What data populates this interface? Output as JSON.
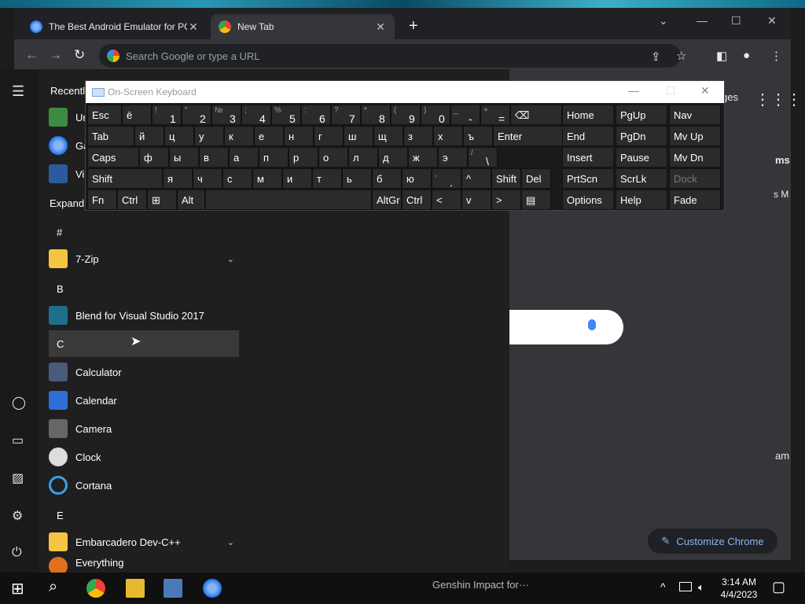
{
  "browser": {
    "tabs": [
      {
        "title": "The Best Android Emulator for PC",
        "close": "✕"
      },
      {
        "title": "New Tab",
        "close": "✕"
      }
    ],
    "new_tab": "+",
    "window_controls": {
      "search_tabs": "⌄",
      "minimize": "—",
      "maximize": "☐",
      "close": "✕"
    },
    "toolbar": {
      "back": "←",
      "forward": "→",
      "reload": "↻",
      "placeholder": "Search Google or type a URL",
      "share": "⇪",
      "bookmark": "☆",
      "sidebar": "◧",
      "profile": "●",
      "menu": "⋮"
    },
    "page": {
      "images_link": "ges",
      "apps_icon": "⋮⋮⋮",
      "customize_label": "Customize Chrome",
      "customize_icon": "✎",
      "side_fragments": [
        "ms",
        "s M",
        "am",
        ")"
      ]
    }
  },
  "start_menu": {
    "hamburger": "☰",
    "recently_added": "Recently",
    "recent": [
      {
        "label": "Ur"
      },
      {
        "label": "Ga"
      },
      {
        "label": "Vi"
      }
    ],
    "expand_label": "Expand",
    "sections": [
      {
        "header": "#",
        "apps": [
          {
            "label": "7-Zip",
            "icon": "folder-icon",
            "expand": "⌄"
          }
        ]
      },
      {
        "header": "B",
        "apps": [
          {
            "label": "Blend for Visual Studio 2017",
            "icon": "blend-icon"
          }
        ]
      },
      {
        "header": "C",
        "apps": [
          {
            "label": "Calculator",
            "icon": "calculator-icon"
          },
          {
            "label": "Calendar",
            "icon": "calendar-icon"
          },
          {
            "label": "Camera",
            "icon": "camera-icon"
          },
          {
            "label": "Clock",
            "icon": "clock-icon"
          },
          {
            "label": "Cortana",
            "icon": "cortana-icon"
          }
        ]
      },
      {
        "header": "E",
        "apps": [
          {
            "label": "Embarcadero Dev-C++",
            "icon": "folder-icon",
            "expand": "⌄"
          },
          {
            "label": "Everything",
            "icon": "everything-icon"
          }
        ]
      }
    ],
    "rail": {
      "user": "◯",
      "documents": "▭",
      "pictures": "▨",
      "settings": "⚙",
      "power": "⏻"
    }
  },
  "osk": {
    "title": "On-Screen Keyboard",
    "controls": {
      "minimize": "—",
      "maximize": "☐",
      "close": "✕"
    },
    "rows": [
      [
        {
          "m": "Esc"
        },
        {
          "m": "ё"
        },
        {
          "s": "!",
          "n": "1"
        },
        {
          "s": "\"",
          "n": "2"
        },
        {
          "s": "№",
          "n": "3"
        },
        {
          "s": ";",
          "n": "4"
        },
        {
          "s": "%",
          "n": "5"
        },
        {
          "s": ":",
          "n": "6"
        },
        {
          "s": "?",
          "n": "7"
        },
        {
          "s": "*",
          "n": "8"
        },
        {
          "s": "(",
          "n": "9"
        },
        {
          "s": ")",
          "n": "0"
        },
        {
          "s": "_",
          "n": "-"
        },
        {
          "s": "+",
          "n": "="
        },
        {
          "m": "⌫"
        }
      ],
      [
        {
          "m": "Tab"
        },
        {
          "m": "й"
        },
        {
          "m": "ц"
        },
        {
          "m": "у"
        },
        {
          "m": "к"
        },
        {
          "m": "е"
        },
        {
          "m": "н"
        },
        {
          "m": "г"
        },
        {
          "m": "ш"
        },
        {
          "m": "щ"
        },
        {
          "m": "з"
        },
        {
          "m": "х"
        },
        {
          "m": "ъ"
        },
        {
          "m": "Enter"
        }
      ],
      [
        {
          "m": "Caps"
        },
        {
          "m": "ф"
        },
        {
          "m": "ы"
        },
        {
          "m": "в"
        },
        {
          "m": "а"
        },
        {
          "m": "п"
        },
        {
          "m": "р"
        },
        {
          "m": "о"
        },
        {
          "m": "л"
        },
        {
          "m": "д"
        },
        {
          "m": "ж"
        },
        {
          "m": "э"
        },
        {
          "s": "/",
          "n": "\\"
        }
      ],
      [
        {
          "m": "Shift"
        },
        {
          "m": "я"
        },
        {
          "m": "ч"
        },
        {
          "m": "с"
        },
        {
          "m": "м"
        },
        {
          "m": "и"
        },
        {
          "m": "т"
        },
        {
          "m": "ь"
        },
        {
          "m": "б"
        },
        {
          "m": "ю"
        },
        {
          "s": ",",
          "n": "."
        },
        {
          "m": "^"
        },
        {
          "m": "Shift"
        },
        {
          "m": "Del"
        }
      ],
      [
        {
          "m": "Fn"
        },
        {
          "m": "Ctrl"
        },
        {
          "m": "⊞"
        },
        {
          "m": "Alt"
        },
        {
          "m": ""
        },
        {
          "m": "AltGr"
        },
        {
          "m": "Ctrl"
        },
        {
          "m": "<"
        },
        {
          "m": "v"
        },
        {
          "m": ">"
        },
        {
          "m": "▤"
        }
      ]
    ],
    "nav_keys": [
      [
        "Home",
        "PgUp",
        "Nav"
      ],
      [
        "End",
        "PgDn",
        "Mv Up"
      ],
      [
        "Insert",
        "Pause",
        "Mv Dn"
      ],
      [
        "PrtScn",
        "ScrLk",
        "Dock"
      ],
      [
        "Options",
        "Help",
        "Fade"
      ]
    ]
  },
  "taskbar": {
    "start": "⊞",
    "search": "⌕",
    "game_label": "Genshin Impact for···",
    "tray_chevron": "^",
    "time": "3:14 AM",
    "date": "4/4/2023",
    "notifications": "▢"
  }
}
